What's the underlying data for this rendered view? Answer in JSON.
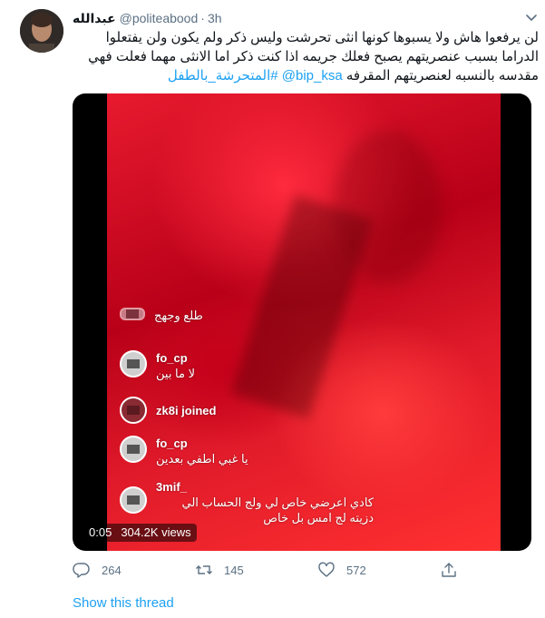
{
  "tweet": {
    "display_name": "عبدالله",
    "handle": "@politeabood",
    "dot": "·",
    "time": "3h",
    "text_line1": "لن يرفعوا هاش ولا يسبوها كونها انثى تحرشت وليس ذكر ولم يكون ولن يفتعلوا",
    "text_line2": "الدراما بسبب عنصريتهم يصبح فعلك جريمه اذا كنت ذكر اما الانثى مهما فعلت فهي",
    "text_line3_plain": "مقدسه بالنسبه لعنصريتهم المقرفه",
    "mention": "@bip_ksa",
    "hashtag": "#المتحرشة_بالطفل"
  },
  "video": {
    "comments": [
      {
        "user": "",
        "msg": "طلع وجهج"
      },
      {
        "user": "fo_cp",
        "msg": "لا ما بين"
      },
      {
        "user": "zk8i joined",
        "msg": ""
      },
      {
        "user": "fo_cp",
        "msg": "يا غبي اطفي بعدين"
      },
      {
        "user": "3mif_",
        "msg": "كادي اعرضي خاص لي ولج الحساب الي دزيته لج امس بل خاص"
      }
    ],
    "duration": "0:05",
    "views": "304.2K views"
  },
  "actions": {
    "reply_count": "264",
    "retweet_count": "145",
    "like_count": "572"
  },
  "show_thread_label": "Show this thread",
  "colors": {
    "accent": "#1da1f2",
    "muted": "#5b7083"
  }
}
